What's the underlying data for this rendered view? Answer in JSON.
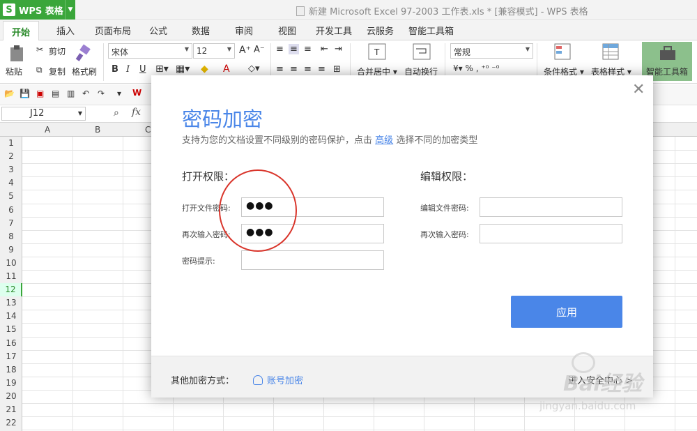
{
  "app": {
    "name": "WPS 表格",
    "doc_title": "新建 Microsoft Excel 97-2003 工作表.xls * [兼容模式] - WPS 表格"
  },
  "tabs": [
    "开始",
    "插入",
    "页面布局",
    "公式",
    "数据",
    "审阅",
    "视图",
    "开发工具",
    "云服务",
    "智能工具箱"
  ],
  "ribbon": {
    "paste": "粘贴",
    "cut": "剪切",
    "copy": "复制",
    "format_painter": "格式刷",
    "font_name": "宋体",
    "font_size": "12",
    "merge_center": "合并居中",
    "wrap_text": "自动换行",
    "number_format": "常规",
    "conditional_format": "条件格式",
    "table_style": "表格样式",
    "smart_toolbox": "智能工具箱"
  },
  "formula_bar": {
    "cell_ref": "J12",
    "fx": "fx"
  },
  "grid": {
    "columns": [
      "A",
      "B",
      "C"
    ],
    "rows": [
      "1",
      "2",
      "3",
      "4",
      "5",
      "6",
      "7",
      "8",
      "9",
      "10",
      "11",
      "12",
      "13",
      "14",
      "15",
      "16",
      "17",
      "18",
      "19",
      "20",
      "21",
      "22"
    ],
    "selected_row": "12"
  },
  "dialog": {
    "title": "密码加密",
    "subtitle_pre": "支持为您的文档设置不同级别的密码保护，点击",
    "subtitle_link": "高级",
    "subtitle_post": "选择不同的加密类型",
    "open_section": "打开权限：",
    "edit_section": "编辑权限：",
    "open_password_label": "打开文件密码:",
    "open_password_value": "●●●",
    "open_confirm_label": "再次输入密码:",
    "open_confirm_value": "●●●",
    "hint_label": "密码提示:",
    "hint_value": "",
    "edit_password_label": "编辑文件密码:",
    "edit_password_value": "",
    "edit_confirm_label": "再次输入密码:",
    "edit_confirm_value": "",
    "apply": "应用",
    "footer_label": "其他加密方式：",
    "account_encrypt": "账号加密",
    "advanced_center": "进入安全中心 >"
  },
  "watermark": {
    "line1": "Bai经验",
    "line2": "jingyan.baidu.com"
  }
}
